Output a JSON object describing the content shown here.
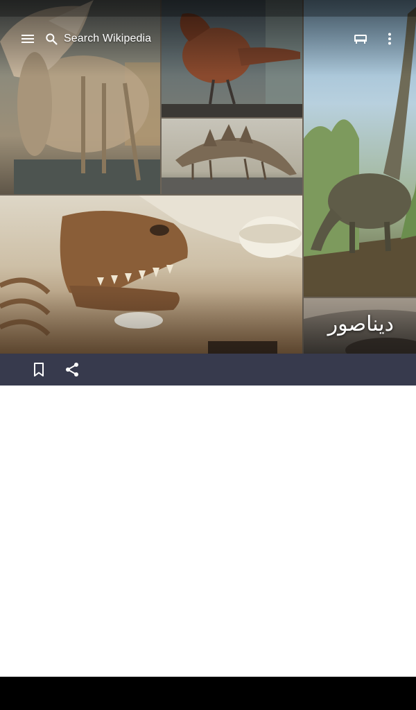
{
  "toolbar": {
    "menu_icon": "hamburger-menu-icon",
    "search_icon": "search-icon",
    "search_placeholder": "Search Wikipedia",
    "reading_icon": "reading-list-icon",
    "overflow_icon": "more-vert-icon"
  },
  "article": {
    "title": "ديناصور"
  },
  "actions": {
    "bookmark_icon": "bookmark-outline-icon",
    "share_icon": "share-icon"
  },
  "colors": {
    "action_bar": "#373a4d",
    "text_on_image": "#ffffff",
    "nav_bar": "#000000"
  }
}
